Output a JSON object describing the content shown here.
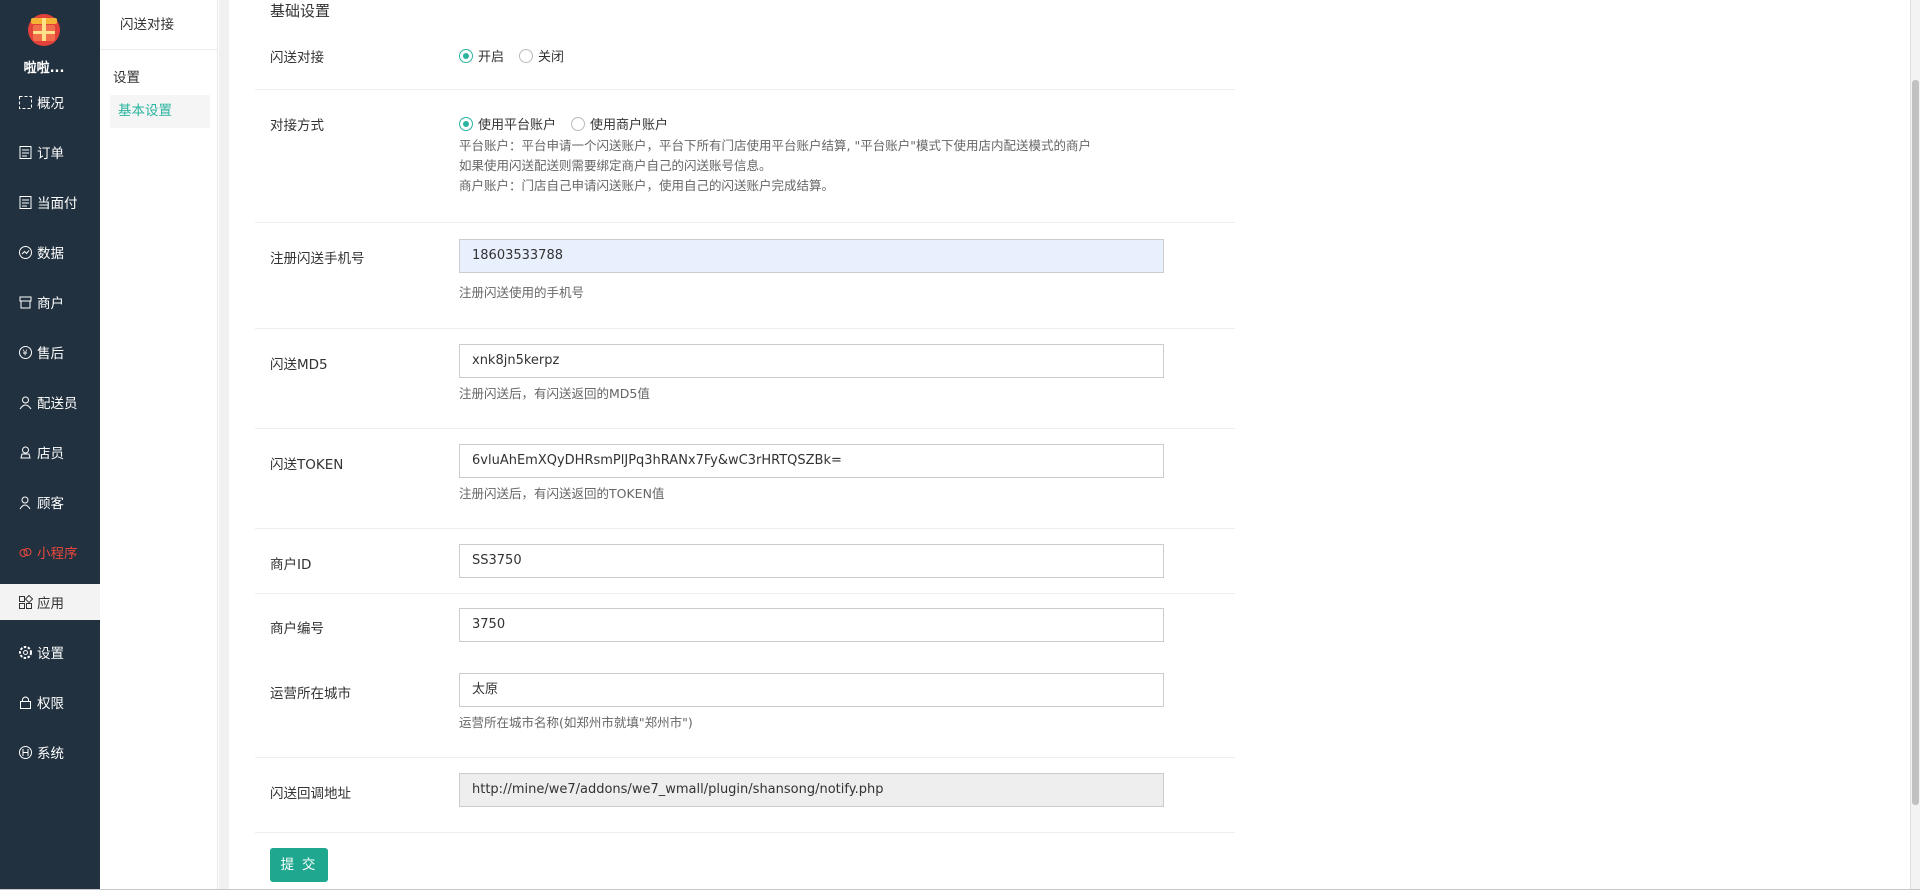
{
  "nav": {
    "shop_name": "啦啦...",
    "items": [
      {
        "label": "概况",
        "icon": "overview-icon"
      },
      {
        "label": "订单",
        "icon": "order-icon"
      },
      {
        "label": "当面付",
        "icon": "pay-icon"
      },
      {
        "label": "数据",
        "icon": "data-icon"
      },
      {
        "label": "商户",
        "icon": "store-icon"
      },
      {
        "label": "售后",
        "icon": "aftersale-icon"
      },
      {
        "label": "配送员",
        "icon": "courier-icon"
      },
      {
        "label": "店员",
        "icon": "clerk-icon"
      },
      {
        "label": "顾客",
        "icon": "customer-icon"
      },
      {
        "label": "小程序",
        "icon": "miniprogram-icon"
      },
      {
        "label": "应用",
        "icon": "apps-icon"
      },
      {
        "label": "设置",
        "icon": "gear-icon"
      },
      {
        "label": "权限",
        "icon": "lock-icon"
      },
      {
        "label": "系统",
        "icon": "system-icon"
      }
    ],
    "active_index": 10,
    "accent_color": "#2ab4a0",
    "alert_color": "#e8483c"
  },
  "subnav": {
    "header": "闪送对接",
    "group": "设置",
    "item": "基本设置"
  },
  "form": {
    "section_title": "基础设置",
    "enable": {
      "label": "闪送对接",
      "options": [
        "开启",
        "关闭"
      ],
      "selected": "开启"
    },
    "mode": {
      "label": "对接方式",
      "options": [
        "使用平台账户",
        "使用商户账户"
      ],
      "selected": "使用平台账户",
      "help1": "平台账户：平台申请一个闪送账户，平台下所有门店使用平台账户结算, \"平台账户\"模式下使用店内配送模式的商户",
      "help2": "如果使用闪送配送则需要绑定商户自己的闪送账号信息。",
      "help3": "商户账户：门店自己申请闪送账户，使用自己的闪送账户完成结算。"
    },
    "phone": {
      "label": "注册闪送手机号",
      "value": "18603533788",
      "help": "注册闪送使用的手机号"
    },
    "md5": {
      "label": "闪送MD5",
      "value": "xnk8jn5kerpz",
      "help": "注册闪送后，有闪送返回的MD5值"
    },
    "token": {
      "label": "闪送TOKEN",
      "value": "6vluAhEmXQyDHRsmPlJPq3hRANx7Fy&wC3rHRTQSZBk=",
      "help": "注册闪送后，有闪送返回的TOKEN值"
    },
    "merchant_id": {
      "label": "商户ID",
      "value": "SS3750"
    },
    "merchant_no": {
      "label": "商户编号",
      "value": "3750"
    },
    "city": {
      "label": "运营所在城市",
      "value": "太原",
      "help": "运营所在城市名称(如郑州市就填\"郑州市\")"
    },
    "callback": {
      "label": "闪送回调地址",
      "value": "http://mine/we7/addons/we7_wmall/plugin/shansong/notify.php"
    },
    "submit": "提 交"
  }
}
